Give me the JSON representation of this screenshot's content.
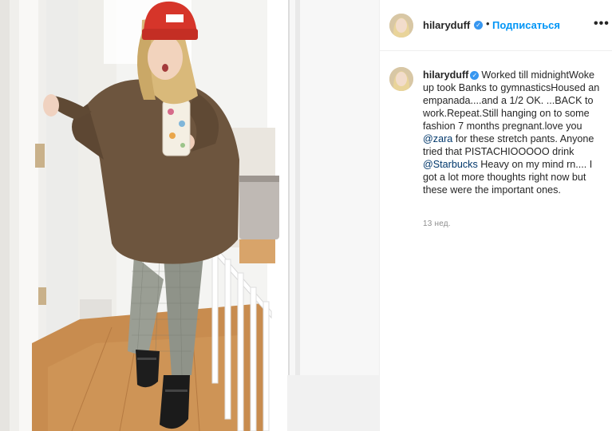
{
  "post": {
    "username": "hilaryduff",
    "verified_icon": "verified-badge-icon",
    "separator": "•",
    "follow_label": "Подписаться",
    "more_icon_glyph": "•••",
    "caption": {
      "username": "hilaryduff",
      "part1": "Worked till midnightWoke up took Banks to gymnasticsHoused an empanada....and a 1/2 OK. ...BACK to work.Repeat.Still hanging on to some fashion 7 months pregnant.love you ",
      "mention1": "@zara",
      "part2": " for these stretch pants. Anyone tried that PISTACHIOOOOO drink ",
      "mention2": "@Starbucks",
      "part3": " Heavy on my mind rn.... I got a lot more thoughts right now but these were the important ones."
    },
    "timestamp": "13 нед.",
    "colors": {
      "link_blue": "#0095f6",
      "verified_blue": "#3897f0",
      "mention": "#00376b",
      "muted": "#8e8e8e"
    }
  }
}
